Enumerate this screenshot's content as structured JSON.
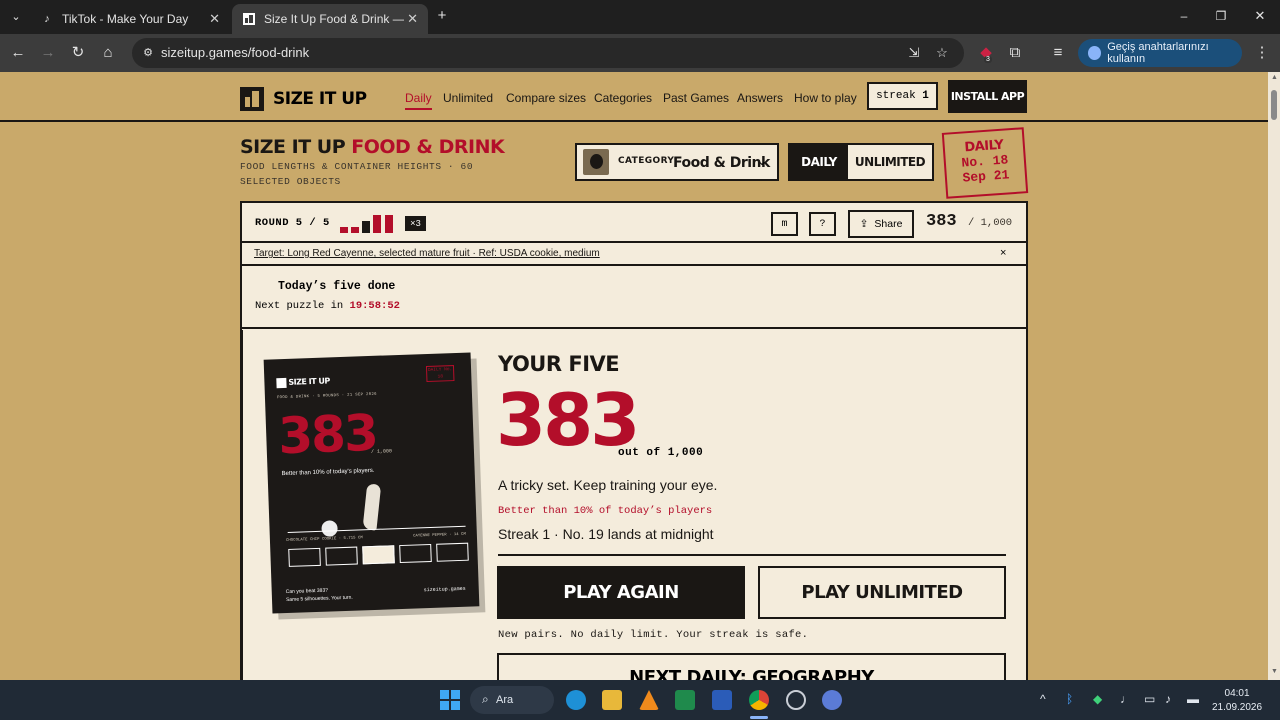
{
  "browser": {
    "tabs": [
      {
        "title": "TikTok - Make Your Day",
        "icon": "tiktok-icon"
      },
      {
        "title": "Size It Up Food & Drink — Food",
        "icon": "sizeitup-icon"
      }
    ],
    "url": "sizeitup.games/food-drink",
    "passkey_label": "Geçiş anahtarlarınızı kullanın",
    "extension_badge": "3"
  },
  "site": {
    "logo_text": "SIZE IT UP",
    "nav": [
      "Daily",
      "Unlimited",
      "Compare sizes",
      "Categories",
      "Past Games",
      "Answers",
      "How to play"
    ],
    "streak_label": "streak",
    "streak_value": "1",
    "install_label": "INSTALL APP"
  },
  "header": {
    "title_main": "SIZE IT UP",
    "title_accent": "FOOD & DRINK",
    "subtitle": "FOOD LENGTHS & CONTAINER HEIGHTS · 60 SELECTED OBJECTS",
    "category_label": "CATEGORY",
    "category_value": "Food & Drink",
    "mode_daily": "DAILY",
    "mode_unlimited": "UNLIMITED",
    "stamp_line1": "DAILY",
    "stamp_line2": "No. 18",
    "stamp_line3": "Sep 21"
  },
  "round": {
    "label": "ROUND 5 / 5",
    "multiplier": "×3",
    "btn_m": "m",
    "btn_help": "?",
    "share_label": "Share",
    "score": "383",
    "score_of": "/ 1,000"
  },
  "target": {
    "text": "Target: Long Red Cayenne, selected mature fruit · Ref: USDA cookie, medium",
    "close": "×"
  },
  "done": {
    "title": "Today’s five done",
    "next_label": "Next puzzle in",
    "countdown": "19:58:52"
  },
  "share_card": {
    "title": "SIZE IT UP",
    "meta": "FOOD & DRINK · 5 ROUNDS · 21 SEP 2026",
    "stamp": "DAILY No. 18",
    "score": "383",
    "of": "/ 1,000",
    "better": "Better than 10% of today's players.",
    "left_item": "CHOCOLATE CHIP COOKIE · 5.715 CM",
    "right_item": "CAYENNE PEPPER · 14 CM",
    "footer_line1": "Can you beat 383?",
    "footer_line2": "Same 5 silhouettes. Your turn.",
    "footer_url": "sizeitup.games"
  },
  "results": {
    "heading": "YOUR FIVE",
    "score": "383",
    "out_of": "out of 1,000",
    "verdict": "A tricky set. Keep training your eye.",
    "better": "Better than 10% of today’s players",
    "streak_line": "Streak 1 · No. 19 lands at midnight",
    "play_again": "PLAY AGAIN",
    "play_unlimited": "PLAY UNLIMITED",
    "new_pairs": "New pairs. No daily limit. Your streak is safe.",
    "next_daily": "NEXT DAILY: GEOGRAPHY"
  },
  "taskbar": {
    "search": "Ara",
    "time": "04:01",
    "date": "21.09.2026"
  },
  "colors": {
    "page_bg": "#c9a96a",
    "panel_bg": "#f4ecdc",
    "accent": "#b30e2a",
    "ink": "#1a1714"
  }
}
